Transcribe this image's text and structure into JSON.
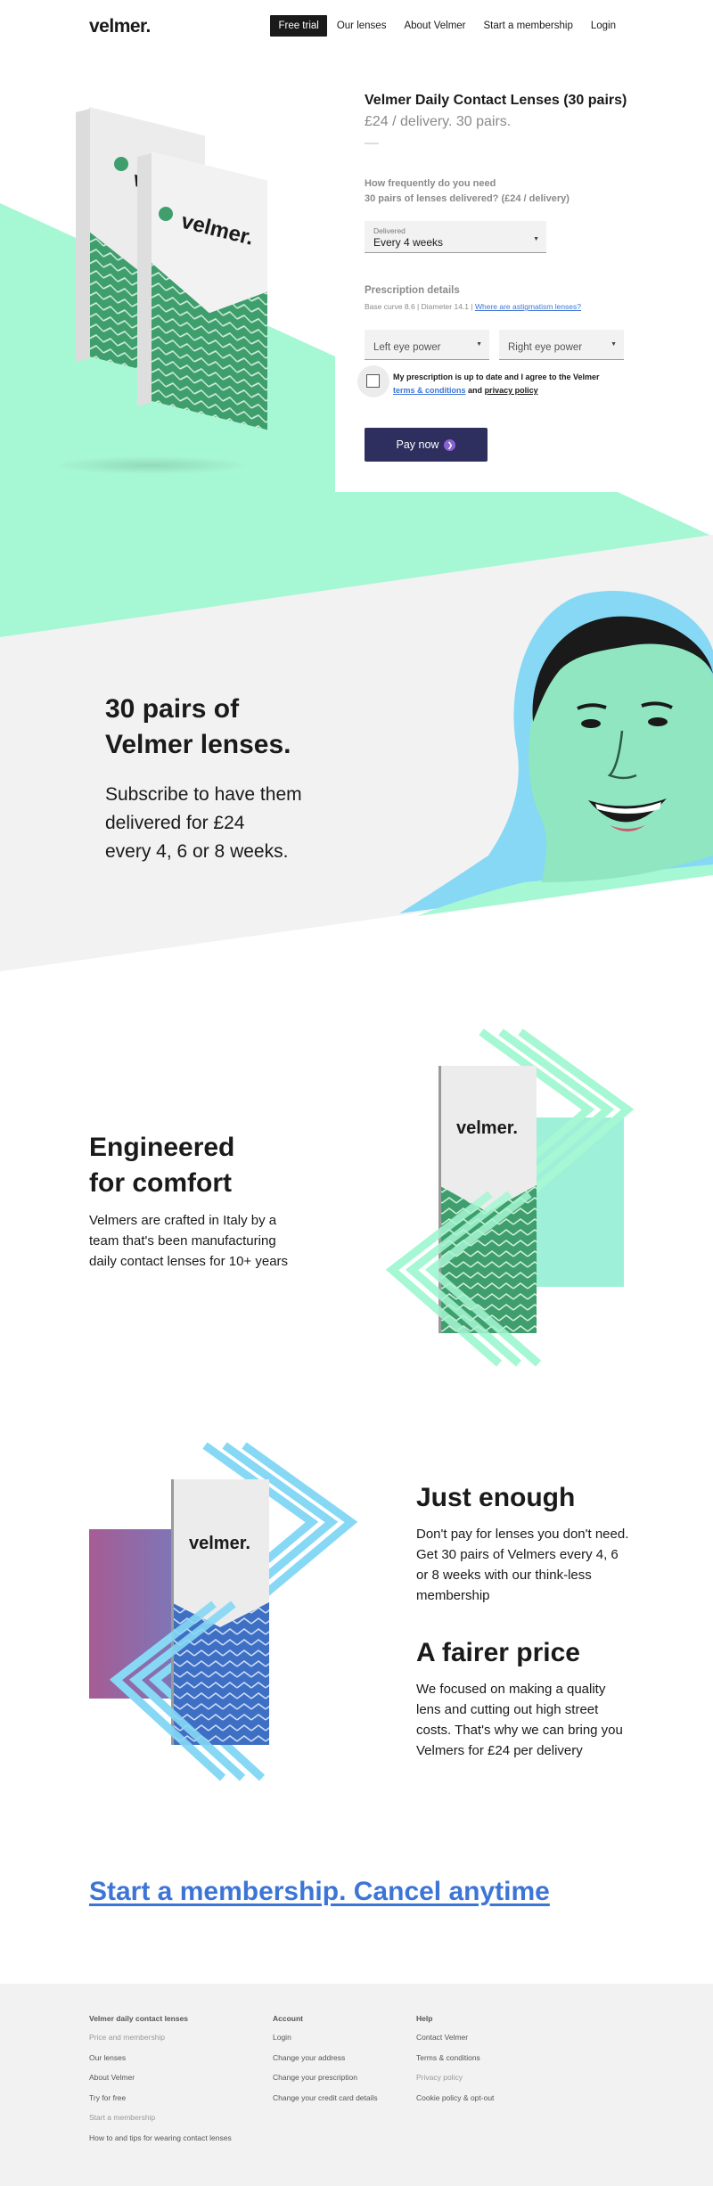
{
  "header": {
    "logo": "velmer.",
    "nav": {
      "free_trial": "Free trial",
      "our_lenses": "Our lenses",
      "about": "About Velmer",
      "start_membership": "Start a membership",
      "login": "Login"
    }
  },
  "product": {
    "box_logo": "velmer.",
    "title": "Velmer Daily Contact Lenses (30 pairs)",
    "subtitle": "£24 / delivery. 30 pairs.",
    "frequency_question_line1": "How frequently do you need",
    "frequency_question_line2": "30 pairs of lenses delivered? (£24 / delivery)",
    "delivery_select": {
      "caption": "Delivered",
      "value": "Every 4 weeks"
    },
    "prescription": {
      "heading": "Prescription details",
      "meta": "Base curve 8.6 | Diameter 14.1 |",
      "astigmatism_link": "Where are astigmatism lenses?",
      "left_eye_placeholder": "Left eye power",
      "right_eye_placeholder": "Right eye power"
    },
    "agree": {
      "text_1": "My prescription is up to date and I agree to the Velmer",
      "terms_link": "terms & conditions",
      "and": "and",
      "privacy_link": "privacy policy",
      "checked": false
    },
    "pay_button": "Pay now"
  },
  "subscribe": {
    "heading_line1": "30 pairs of",
    "heading_line2": "Velmer lenses.",
    "body_line1": "Subscribe to have them",
    "body_line2": "delivered for £24",
    "body_line3": "every 4, 6 or 8 weeks."
  },
  "engineered": {
    "heading_line1": "Engineered",
    "heading_line2": "for comfort",
    "body": "Velmers are crafted in Italy by a team that's been manufacturing daily contact lenses for 10+ years",
    "box_logo": "velmer."
  },
  "just_enough": {
    "heading": "Just enough",
    "body": "Don't pay for lenses you don't need. Get 30 pairs of Velmers every 4, 6 or 8 weeks with our think-less membership",
    "box_logo": "velmer."
  },
  "fairer_price": {
    "heading": "A fairer price",
    "body": "We focused on making a quality lens and cutting out high street costs. That's why we can bring you Velmers for £24 per delivery"
  },
  "cta": "Start a membership. Cancel anytime",
  "footer": {
    "col1": {
      "heading": "Velmer daily contact lenses",
      "links": [
        "Price and membership",
        "Our lenses",
        "About Velmer",
        "Try for free",
        "Start a membership",
        "How to and tips for wearing contact lenses"
      ]
    },
    "col2": {
      "heading": "Account",
      "links": [
        "Login",
        "Change your address",
        "Change your prescription",
        "Change your credit card details"
      ]
    },
    "col3": {
      "heading": "Help",
      "links": [
        "Contact Velmer",
        "Terms & conditions",
        "Privacy policy",
        "Cookie policy & opt-out"
      ]
    }
  },
  "colors": {
    "mint": "#a6f7d3",
    "green_pattern": "#3e9e6c",
    "blue_pattern": "#3d6fc4",
    "sky": "#86d8f5",
    "navy_button": "#2e2f5e",
    "link_blue": "#3d75d6",
    "grey_band": "#f2f2f2"
  },
  "icons": {
    "select_arrow": "caret-down-icon",
    "pay_icon": "chevron-right-circle-icon"
  }
}
